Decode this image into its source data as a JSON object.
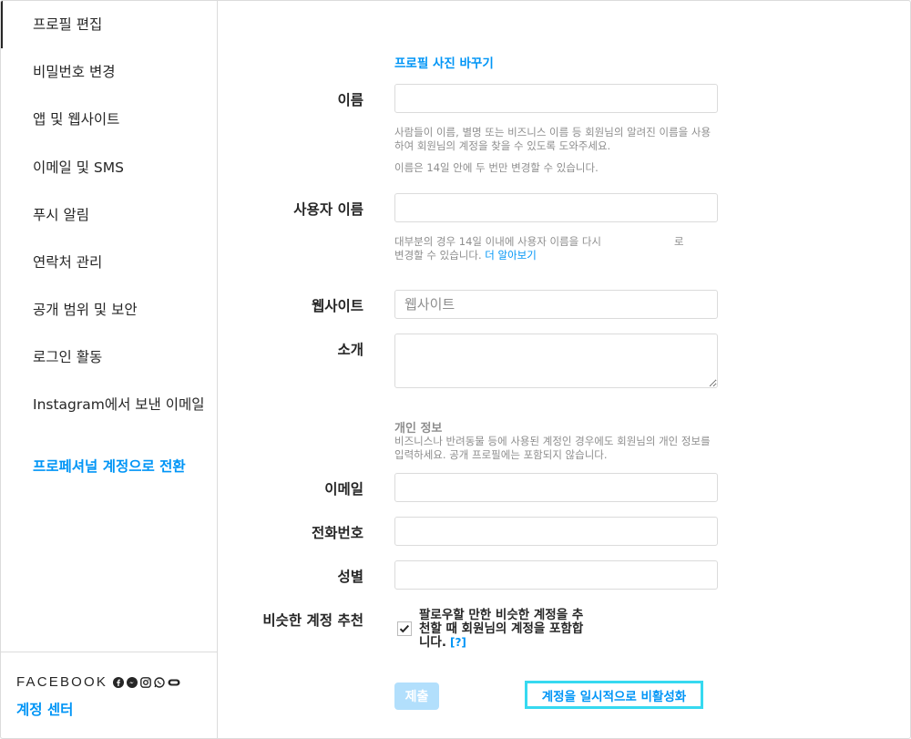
{
  "sidebar": {
    "items": [
      {
        "label": "프로필 편집"
      },
      {
        "label": "비밀번호 변경"
      },
      {
        "label": "앱 및 웹사이트"
      },
      {
        "label": "이메일 및 SMS"
      },
      {
        "label": "푸시 알림"
      },
      {
        "label": "연락처 관리"
      },
      {
        "label": "공개 범위 및 보안"
      },
      {
        "label": "로그인 활동"
      },
      {
        "label": "Instagram에서 보낸 이메일"
      },
      {
        "label": "프로페셔널 계정으로 전환"
      }
    ],
    "facebook": "FACEBOOK",
    "account_center": "계정 센터"
  },
  "form": {
    "change_photo": "프로필 사진 바꾸기",
    "name_label": "이름",
    "name_value": "",
    "name_help1": "사람들이 이름, 별명 또는 비즈니스 이름 등 회원님의 알려진 이름을 사용하여 회원님의 계정을 찾을 수 있도록 도와주세요.",
    "name_help2": "이름은 14일 안에 두 번만 변경할 수 있습니다.",
    "username_label": "사용자 이름",
    "username_value": "",
    "username_help_a": "대부분의 경우 14일 이내에 사용자 이름을 다시",
    "username_help_b": "로",
    "username_help_c": "변경할 수 있습니다.",
    "learn_more": "더 알아보기",
    "website_label": "웹사이트",
    "website_placeholder": "웹사이트",
    "bio_label": "소개",
    "bio_value": "",
    "personal_title": "개인 정보",
    "personal_help": "비즈니스나 반려동물 등에 사용된 계정인 경우에도 회원님의 개인 정보를 입력하세요. 공개 프로필에는 포함되지 않습니다.",
    "email_label": "이메일",
    "email_value": "",
    "phone_label": "전화번호",
    "phone_value": "",
    "gender_label": "성별",
    "gender_value": "",
    "similar_label": "비슷한 계정 추천",
    "similar_text": "팔로우할 만한 비슷한 계정을 추천할 때 회원님의 계정을 포함합니다.",
    "similar_help": "[?]",
    "similar_checked": true,
    "submit_label": "제출",
    "deactivate_label": "계정을 일시적으로 비활성화"
  }
}
